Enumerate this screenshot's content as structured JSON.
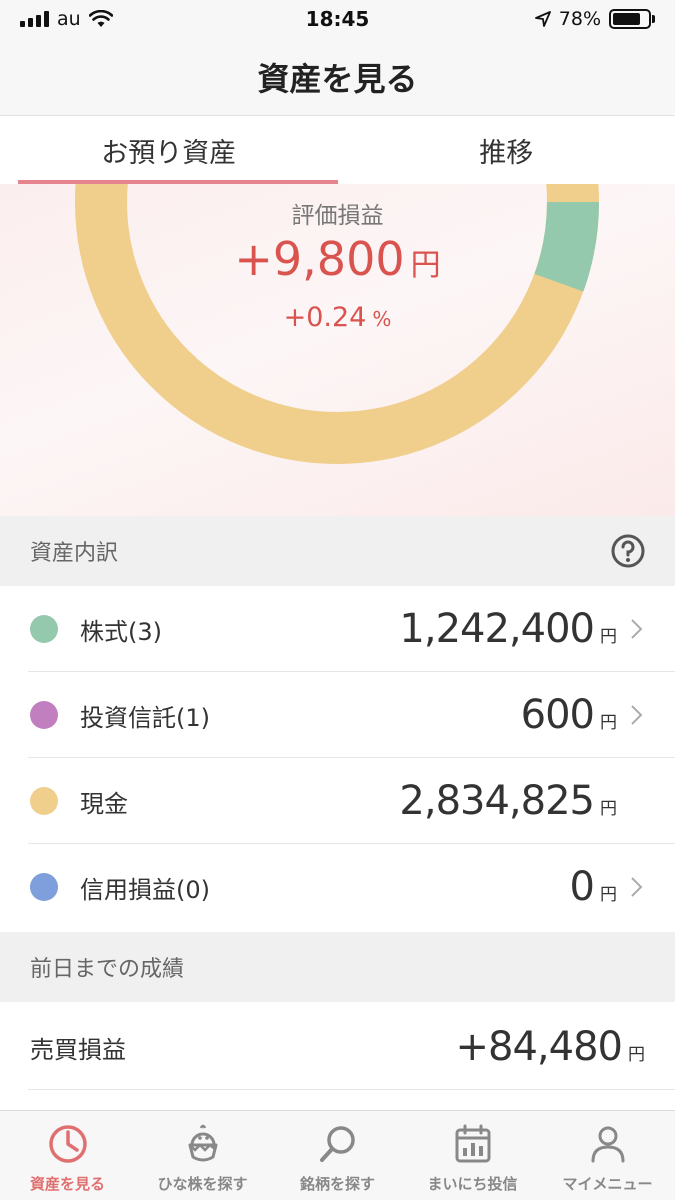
{
  "status_bar": {
    "carrier": "au",
    "time": "18:45",
    "battery": "78%",
    "battery_level": 0.78
  },
  "nav": {
    "title": "資産を見る"
  },
  "tabs": [
    {
      "label": "お預り資産",
      "active": true
    },
    {
      "label": "推移",
      "active": false
    }
  ],
  "summary": {
    "label": "評価損益",
    "value": "+9,800",
    "value_unit": "円",
    "percent": "+0.24",
    "percent_unit": "%"
  },
  "breakdown": {
    "header": "資産内訳",
    "items": [
      {
        "label": "株式(3)",
        "value": "1,242,400",
        "unit": "円",
        "color": "#94c9ad",
        "chevron": true
      },
      {
        "label": "投資信託(1)",
        "value": "600",
        "unit": "円",
        "color": "#c27fbf",
        "chevron": true
      },
      {
        "label": "現金",
        "value": "2,834,825",
        "unit": "円",
        "color": "#f0ce8c",
        "chevron": false
      },
      {
        "label": "信用損益(0)",
        "value": "0",
        "unit": "円",
        "color": "#7f9fdc",
        "chevron": true
      }
    ]
  },
  "performance": {
    "header": "前日までの成績",
    "items": [
      {
        "label": "売買損益",
        "value": "+84,480",
        "unit": "円"
      }
    ]
  },
  "tabbar": [
    {
      "label": "資産を見る",
      "icon": "pie-chart-icon",
      "active": true
    },
    {
      "label": "ひな株を探す",
      "icon": "chick-icon",
      "active": false
    },
    {
      "label": "銘柄を探す",
      "icon": "search-icon",
      "active": false
    },
    {
      "label": "まいにち投信",
      "icon": "calendar-icon",
      "active": false
    },
    {
      "label": "マイメニュー",
      "icon": "person-icon",
      "active": false
    }
  ],
  "colors": {
    "accent": "#e5848f",
    "gain": "#d9534f"
  }
}
